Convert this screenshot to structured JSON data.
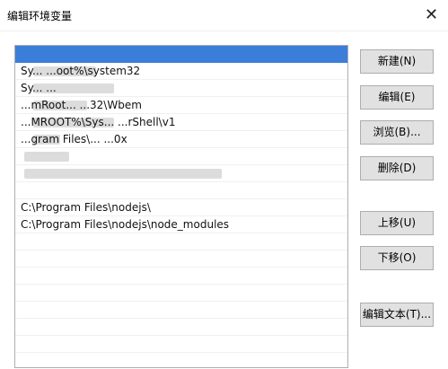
{
  "window": {
    "title": "编辑环境变量",
    "close_glyph": "✕"
  },
  "path_list": {
    "items": [
      {
        "text": "",
        "selected": true
      },
      {
        "text": "Sy... ...oot%\\system32",
        "selected": false
      },
      {
        "text": "Sy... ...",
        "selected": false
      },
      {
        "text": "...mRoot... ...32\\Wbem",
        "selected": false
      },
      {
        "text": "...MROOT%\\Sys... ...rShell\\v1",
        "selected": false
      },
      {
        "text": "...gram Files\\... ...0x",
        "selected": false
      },
      {
        "text": "",
        "selected": false
      },
      {
        "text": "",
        "selected": false
      },
      {
        "text": "",
        "selected": false
      },
      {
        "text": "C:\\Program Files\\nodejs\\",
        "selected": false
      },
      {
        "text": "C:\\Program Files\\nodejs\\node_modules",
        "selected": false
      },
      {
        "text": "",
        "selected": false
      },
      {
        "text": "",
        "selected": false
      },
      {
        "text": "",
        "selected": false
      },
      {
        "text": "",
        "selected": false
      },
      {
        "text": "",
        "selected": false
      },
      {
        "text": "",
        "selected": false
      },
      {
        "text": "",
        "selected": false
      }
    ]
  },
  "buttons": {
    "new": "新建(N)",
    "edit": "编辑(E)",
    "browse": "浏览(B)...",
    "delete": "删除(D)",
    "move_up": "上移(U)",
    "move_down": "下移(O)",
    "edit_text": "编辑文本(T)..."
  },
  "colors": {
    "selection": "#3b7ed9",
    "button_face": "#e1e1e1"
  }
}
